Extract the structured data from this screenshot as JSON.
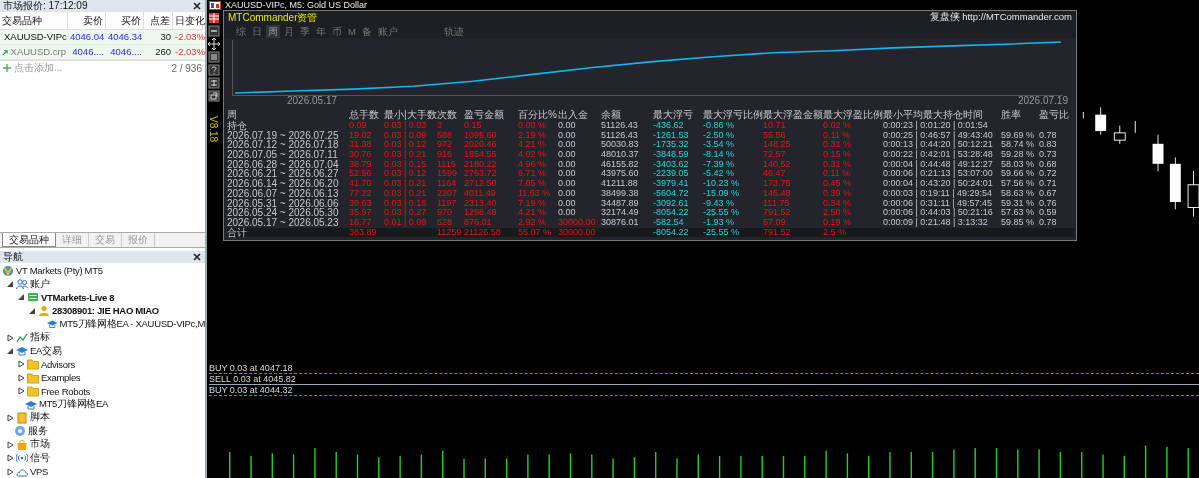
{
  "market_watch": {
    "title": "市场报价: 17:12:09",
    "columns": [
      "交易品种",
      "卖价",
      "买价",
      "点差",
      "日变化"
    ],
    "rows": [
      {
        "symbol": "XAUUSD-VIPc",
        "bid": "4046.04",
        "ask": "4046.34",
        "spread": "30",
        "change": "-2.03%",
        "dimmed": false
      },
      {
        "symbol": "XAUUSD.crp",
        "bid": "4046....",
        "ask": "4046....",
        "spread": "260",
        "change": "-2.03%",
        "dimmed": true
      }
    ],
    "add_label": "点击添加...",
    "count": "2 / 936",
    "tabs": [
      {
        "label": "交易品种",
        "selected": true
      },
      {
        "label": "详细",
        "selected": false
      },
      {
        "label": "交易",
        "selected": false
      },
      {
        "label": "报价",
        "selected": false
      }
    ]
  },
  "navigator": {
    "title": "导航",
    "tree": [
      {
        "label": "VT Markets (Pty) MT5",
        "kind": "logo",
        "children": [
          {
            "label": "账户",
            "kind": "accounts",
            "expanded": true,
            "leaf": false,
            "bold": false,
            "children": [
              {
                "label": "VTMarkets-Live 8",
                "kind": "server",
                "expanded": true,
                "leaf": false,
                "bold": true,
                "children": [
                  {
                    "label": "28308901: JIE HAO MIAO",
                    "kind": "user",
                    "expanded": true,
                    "leaf": false,
                    "bold": true,
                    "children": [
                      {
                        "label": "MT5刀锋网格EA - XAUUSD-VIPc,M",
                        "kind": "expert",
                        "expanded": false,
                        "leaf": true,
                        "bold": false
                      }
                    ]
                  }
                ]
              }
            ]
          },
          {
            "label": "指标",
            "kind": "indicator",
            "expanded": false,
            "leaf": false,
            "bold": false
          },
          {
            "label": "EA交易",
            "kind": "expert",
            "expanded": true,
            "leaf": false,
            "bold": false,
            "children": [
              {
                "label": "Advisors",
                "kind": "folder",
                "expanded": false,
                "leaf": false,
                "bold": false
              },
              {
                "label": "Examples",
                "kind": "folder",
                "expanded": false,
                "leaf": false,
                "bold": false
              },
              {
                "label": "Free Robots",
                "kind": "folder",
                "expanded": false,
                "leaf": false,
                "bold": false
              },
              {
                "label": "MT5刀锋网格EA",
                "kind": "expert",
                "expanded": false,
                "leaf": true,
                "bold": false
              }
            ]
          },
          {
            "label": "脚本",
            "kind": "script",
            "expanded": false,
            "leaf": false,
            "bold": false
          },
          {
            "label": "服务",
            "kind": "service",
            "expanded": false,
            "leaf": true,
            "bold": false
          },
          {
            "label": "市场",
            "kind": "market",
            "expanded": false,
            "leaf": false,
            "bold": false
          },
          {
            "label": "信号",
            "kind": "signal",
            "expanded": false,
            "leaf": false,
            "bold": false
          },
          {
            "label": "VPS",
            "kind": "vps",
            "expanded": false,
            "leaf": false,
            "bold": false
          }
        ]
      }
    ]
  },
  "chart": {
    "title": "XAUUSD-VIPc, M5: Gold US Dollar",
    "orders": [
      {
        "kind": "buy",
        "label": "BUY 0.03 at 4047.18"
      },
      {
        "kind": "sell",
        "label": "SELL 0.03 at 4045.82"
      },
      {
        "kind": "buy",
        "label": "BUY 0.03 at 4044.32"
      }
    ]
  },
  "panel": {
    "title": "MTCommander资管",
    "site": "复盘侠 http://MTCommander.com",
    "version": "V8.18",
    "tabs": [
      {
        "label": "综",
        "selected": false
      },
      {
        "label": "日",
        "selected": false
      },
      {
        "label": "周",
        "selected": true
      },
      {
        "label": "月",
        "selected": false
      },
      {
        "label": "季",
        "selected": false
      },
      {
        "label": "年",
        "selected": false
      },
      {
        "label": "币",
        "selected": false
      },
      {
        "label": "M",
        "selected": false
      },
      {
        "label": "备",
        "selected": false
      },
      {
        "label": "账户",
        "selected": false
      },
      {
        "label": "轨迹",
        "selected": false
      }
    ],
    "curve_start": "2026.05.17",
    "curve_end": "2026.07.19",
    "table": {
      "columns": [
        "周",
        "总手数",
        "最小|大手数",
        "次数",
        "盈亏金额",
        "百分比%",
        "出入金",
        "余额",
        "最大浮亏",
        "最大浮亏比例",
        "最大浮盈金额",
        "最大浮盈比例",
        "最小平均最大持仓时间",
        "胜率",
        "盈亏比"
      ],
      "rows": [
        {
          "total": false,
          "deposit_flag": false,
          "cells": [
            "持仓",
            "0.09",
            "0.03 | 0.03",
            "3",
            "0.15",
            "0.00 %",
            "0.00",
            "51126.43",
            "-436.62",
            "-0.86 %",
            "10.71",
            "0.02 %",
            "0:00:23 | 0:01:20 | 0:01:54",
            null,
            null
          ]
        },
        {
          "total": false,
          "deposit_flag": false,
          "cells": [
            "2026.07.19 ~ 2026.07.25",
            "19.02",
            "0.03 | 0.09",
            "588",
            "1095.60",
            "2.19 %",
            "0.00",
            "51126.43",
            "-1261.53",
            "-2.50 %",
            "55.56",
            "0.11 %",
            "0:00:25 | 0:46:57 | 49:43:40",
            "59.69 %",
            "0.78"
          ]
        },
        {
          "total": false,
          "deposit_flag": false,
          "cells": [
            "2026.07.12 ~ 2026.07.18",
            "31.38",
            "0.03 | 0.12",
            "972",
            "2020.46",
            "4.21 %",
            "0.00",
            "50030.83",
            "-1735.32",
            "-3.54 %",
            "148.25",
            "0.31 %",
            "0:00:13 | 0:44:20 | 50:12:21",
            "58.74 %",
            "0.83"
          ]
        },
        {
          "total": false,
          "deposit_flag": false,
          "cells": [
            "2026.07.05 ~ 2026.07.11",
            "30.76",
            "0.03 | 0.21",
            "916",
            "1854.55",
            "4.02 %",
            "0.00",
            "48010.37",
            "-3848.59",
            "-8.14 %",
            "72.57",
            "0.15 %",
            "0:00:22 | 0:42:01 | 53:28:48",
            "59.28 %",
            "0.73"
          ]
        },
        {
          "total": false,
          "deposit_flag": false,
          "cells": [
            "2026.06.28 ~ 2026.07.04",
            "38.79",
            "0.03 | 0.15",
            "1115",
            "2180.22",
            "4.96 %",
            "0.00",
            "46155.82",
            "-3403.62",
            "-7.39 %",
            "140.52",
            "0.31 %",
            "0:00:04 | 0:44:48 | 49:12:27",
            "58.03 %",
            "0.68"
          ]
        },
        {
          "total": false,
          "deposit_flag": false,
          "cells": [
            "2026.06.21 ~ 2026.06.27",
            "52.56",
            "0.03 | 0.12",
            "1599",
            "2763.72",
            "6.71 %",
            "0.00",
            "43975.60",
            "-2239.05",
            "-5.42 %",
            "46.47",
            "0.11 %",
            "0:00:06 | 0:21:13 | 53:07:00",
            "59.66 %",
            "0.72"
          ]
        },
        {
          "total": false,
          "deposit_flag": false,
          "cells": [
            "2026.06.14 ~ 2026.06.20",
            "41.70",
            "0.03 | 0.21",
            "1164",
            "2712.50",
            "7.05 %",
            "0.00",
            "41211.88",
            "-3979.41",
            "-10.23 %",
            "173.75",
            "0.45 %",
            "0:00:04 | 0:43:20 | 50:24:01",
            "57.56 %",
            "0.71"
          ]
        },
        {
          "total": false,
          "deposit_flag": false,
          "cells": [
            "2026.06.07 ~ 2026.06.13",
            "77.22",
            "0.03 | 0.21",
            "2207",
            "4011.49",
            "11.63 %",
            "0.00",
            "38499.38",
            "-5604.72",
            "-15.09 %",
            "146.48",
            "0.39 %",
            "0:00:03 | 0:19:11 | 49:29:54",
            "58.63 %",
            "0.67"
          ]
        },
        {
          "total": false,
          "deposit_flag": false,
          "cells": [
            "2026.05.31 ~ 2026.06.06",
            "39.63",
            "0.03 | 0.18",
            "1197",
            "2313.40",
            "7.19 %",
            "0.00",
            "34487.89",
            "-3092.61",
            "-9.43 %",
            "111.75",
            "0.34 %",
            "0:00:06 | 0:31:11 | 49:57:45",
            "59.31 %",
            "0.76"
          ]
        },
        {
          "total": false,
          "deposit_flag": false,
          "cells": [
            "2026.05.24 ~ 2026.05.30",
            "35.97",
            "0.03 | 0.27",
            "970",
            "1298.48",
            "4.21 %",
            "0.00",
            "32174.49",
            "-8054.22",
            "-25.55 %",
            "791.52",
            "2.50 %",
            "0:00:06 | 0:44:03 | 50:21:16",
            "57.63 %",
            "0.59"
          ]
        },
        {
          "total": false,
          "deposit_flag": true,
          "cells": [
            "2026.05.17 ~ 2026.05.23",
            "16.77",
            "0.01 | 0.09",
            "528",
            "876.01",
            "2.92 %",
            "30000.00",
            "30876.01",
            "-582.54",
            "-1.93 %",
            "57.09",
            "0.19 %",
            "0:00:09 | 0:21:48 | 3:13:32",
            "59.85 %",
            "0.78"
          ]
        },
        {
          "total": true,
          "deposit_flag": true,
          "cells": [
            "合计",
            "383.89",
            null,
            "11259",
            "21126.58",
            "55.07 %",
            "30000.00",
            null,
            "-8054.22",
            "-25.55 %",
            "791.52",
            "2.5 %",
            null,
            null,
            null
          ]
        }
      ]
    }
  }
}
